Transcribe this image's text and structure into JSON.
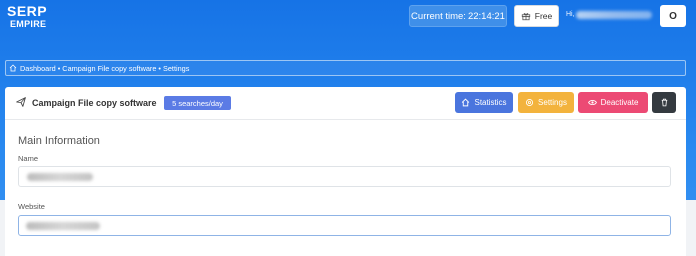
{
  "header": {
    "logo_line1": "SERP",
    "logo_line2": "EMPIRE",
    "current_time_label": "Current time:",
    "current_time_value": "22:14:21",
    "plan_label": "Free",
    "greeting": "Hi,",
    "avatar_initial": "O"
  },
  "breadcrumb": {
    "text": "Dashboard • Campaign File copy software • Settings"
  },
  "card": {
    "title": "Campaign File copy software",
    "badge": "5 searches/day",
    "buttons": {
      "statistics": "Statistics",
      "settings": "Settings",
      "deactivate": "Deactivate"
    },
    "section_title": "Main Information",
    "name_label": "Name",
    "website_label": "Website"
  },
  "colors": {
    "header_bg": "#1673e6",
    "statistics": "#4a75de",
    "settings": "#f3b33d",
    "deactivate": "#ec4a74",
    "trash": "#343a40",
    "badge": "#5b7be5"
  }
}
